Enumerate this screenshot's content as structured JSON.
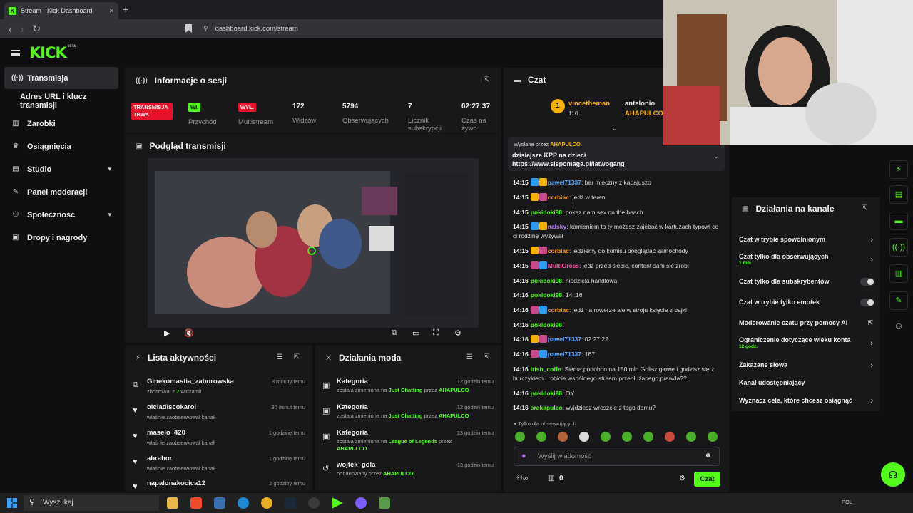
{
  "browser": {
    "tab_title": "Stream - Kick Dashboard",
    "url": "dashboard.kick.com/stream"
  },
  "logo": {
    "text": "KICK",
    "sup": "BETA"
  },
  "sidebar": {
    "items": [
      {
        "label": "Transmisja",
        "icon": "broadcast-icon"
      },
      {
        "label": "Adres URL i klucz transmisji",
        "icon": ""
      },
      {
        "label": "Zarobki",
        "icon": "chart-icon"
      },
      {
        "label": "Osiągnięcia",
        "icon": "trophy-icon"
      },
      {
        "label": "Studio",
        "icon": "studio-icon"
      },
      {
        "label": "Panel moderacji",
        "icon": "wrench-icon"
      },
      {
        "label": "Społeczność",
        "icon": "community-icon"
      },
      {
        "label": "Dropy i nagrody",
        "icon": "gift-icon"
      }
    ]
  },
  "session": {
    "title": "Informacje o sesji",
    "live_badge": "TRANSMISJA TRWA",
    "live_sub": "Sesja",
    "income_badge": "Wł.",
    "income_label": "Przychód",
    "multistream_badge": "WYŁ.",
    "multistream_label": "Multistream",
    "viewers_value": "172",
    "viewers_label": "Widzów",
    "followers_value": "5794",
    "followers_label": "Obserwujących",
    "subs_value": "7",
    "subs_label": "Licznik subskrypcji",
    "time_value": "02:27:37",
    "time_label": "Czas na żywo"
  },
  "preview": {
    "title": "Podgląd transmisji"
  },
  "activity": {
    "title": "Lista aktywności",
    "items": [
      {
        "name": "Ginekomastia_zaborowska",
        "sub_a": "zhostował z ",
        "sub_b": "7",
        "sub_c": " widzami!",
        "time": "3 minuty temu"
      },
      {
        "name": "olciadiscokarol",
        "sub": "właśnie zaobserwował kanał",
        "time": "30 minut temu"
      },
      {
        "name": "maselo_420",
        "sub": "właśnie zaobserwował kanał",
        "time": "1 godzinę temu"
      },
      {
        "name": "abrahor",
        "sub": "właśnie zaobserwował kanał",
        "time": "1 godzinę temu"
      },
      {
        "name": "napalonakocica12",
        "sub": "",
        "time": "2 godziny temu"
      }
    ]
  },
  "modactions": {
    "title": "Działania moda",
    "items": [
      {
        "name": "Kategoria",
        "sub_a": "została zmieniona na ",
        "sub_b": "Just Chatting",
        "sub_c": " przez ",
        "sub_d": "AHAPULCO",
        "time": "12 godzin temu"
      },
      {
        "name": "Kategoria",
        "sub_a": "została zmieniona na ",
        "sub_b": "Just Chatting",
        "sub_c": " przez ",
        "sub_d": "AHAPULCO",
        "time": "12 godzin temu"
      },
      {
        "name": "Kategoria",
        "sub_a": "została zmieniona na ",
        "sub_b": "League of Legends",
        "sub_c": " przez ",
        "sub_d": "AHAPULCO",
        "time": "13 godzin temu"
      },
      {
        "name": "wojtek_gola",
        "sub_a": "odbanowany przez ",
        "sub_b": "AHAPULCO",
        "time": "13 godzin temu"
      }
    ]
  },
  "chat": {
    "title": "Czat",
    "top_user": "vincetheman",
    "top_count": "110",
    "top_user2": "antelonio",
    "top_user3": "AHAPULCO",
    "pinned_by": "Wysłane przez",
    "pinned_user": "AHAPULCO",
    "pinned_text": "dzisiejsze KPP na dzieci",
    "pinned_link": "https://www.siepomaga.pl/latwogang",
    "messages": [
      {
        "time": "14:15",
        "user": "pawel71337",
        "color": "#5aa9ff",
        "text": ": bar mleczny z kabajuszo"
      },
      {
        "time": "14:15",
        "user": "corbiac",
        "color": "#ff9f1a",
        "text": ": jedź w teren"
      },
      {
        "time": "14:15",
        "user": "pokidoki98",
        "color": "#53fc18",
        "text": ": pokaz nam sex on the beach"
      },
      {
        "time": "14:15",
        "user": "nalsky",
        "color": "#c58cff",
        "text": ": kamieniem to ty możesz zajebać w kartuzach typowi co ci rodzinę wyzywał"
      },
      {
        "time": "14:15",
        "user": "corbiac",
        "color": "#ff9f1a",
        "text": ": jedziemy do komisu pooglądać samochody"
      },
      {
        "time": "14:15",
        "user": "MultiGross",
        "color": "#ff4fa3",
        "text": ": jedz przed siebie, content sam sie zrobi"
      },
      {
        "time": "14:16",
        "user": "pokidoki98",
        "color": "#53fc18",
        "text": ": niedziela handlowa"
      },
      {
        "time": "14:16",
        "user": "pokidoki98",
        "color": "#53fc18",
        "text": ": 14 :16"
      },
      {
        "time": "14:16",
        "user": "corbiac",
        "color": "#ff9f1a",
        "text": ": jedź na rowerze ale w stroju księcia z bajki"
      },
      {
        "time": "14:16",
        "user": "pokidoki98",
        "color": "#53fc18",
        "text": ":"
      },
      {
        "time": "14:16",
        "user": "pawel71337",
        "color": "#5aa9ff",
        "text": ": 02:27:22"
      },
      {
        "time": "14:16",
        "user": "pawel71337",
        "color": "#5aa9ff",
        "text": ": 167"
      },
      {
        "time": "14:16",
        "user": "Irish_coffe",
        "color": "#53fc18",
        "text": ": Siema,podobno na 150 mln Golisz głowę i godzisz się z burczykiem i robicie wspólnego stream przedłużanego,prawda??"
      },
      {
        "time": "14:16",
        "user": "pokidoki98",
        "color": "#53fc18",
        "text": ": OY"
      },
      {
        "time": "14:16",
        "user": "srakapulco",
        "color": "#53fc18",
        "text": ": wyjdziesz wreszcie z tego domu?"
      }
    ],
    "followers_only": "Tylko dla obserwujących",
    "input_placeholder": "Wyślij wiadomość",
    "points": "0",
    "send_label": "Czat"
  },
  "channel_actions": {
    "title": "Działania na kanale",
    "items": [
      {
        "label": "Czat w trybie spowolnionym",
        "sub": "",
        "control": "chevron"
      },
      {
        "label": "Czat tylko dla obserwujących",
        "sub": "1 min",
        "control": "chevron"
      },
      {
        "label": "Czat tylko dla subskrybentów",
        "sub": "",
        "control": "toggle"
      },
      {
        "label": "Czat w trybie tylko emotek",
        "sub": "",
        "control": "toggle"
      },
      {
        "label": "Moderowanie czatu przy pomocy AI",
        "sub": "",
        "control": "external"
      },
      {
        "label": "Ograniczenie dotyczące wieku konta",
        "sub": "12 godz.",
        "control": "chevron"
      },
      {
        "label": "Zakazane słowa",
        "sub": "",
        "control": "chevron"
      },
      {
        "label": "Kanał udostępniający",
        "sub": "",
        "control": "none"
      },
      {
        "label": "Wyznacz cele, które chcesz osiągnąć",
        "sub": "",
        "control": "chevron"
      }
    ]
  },
  "taskbar": {
    "search": "Wyszukaj",
    "lang": "POL"
  },
  "colors": {
    "accent": "#53fc18",
    "panel": "#18181a",
    "bg": "#0f0f10",
    "live_red": "#e8132a"
  }
}
